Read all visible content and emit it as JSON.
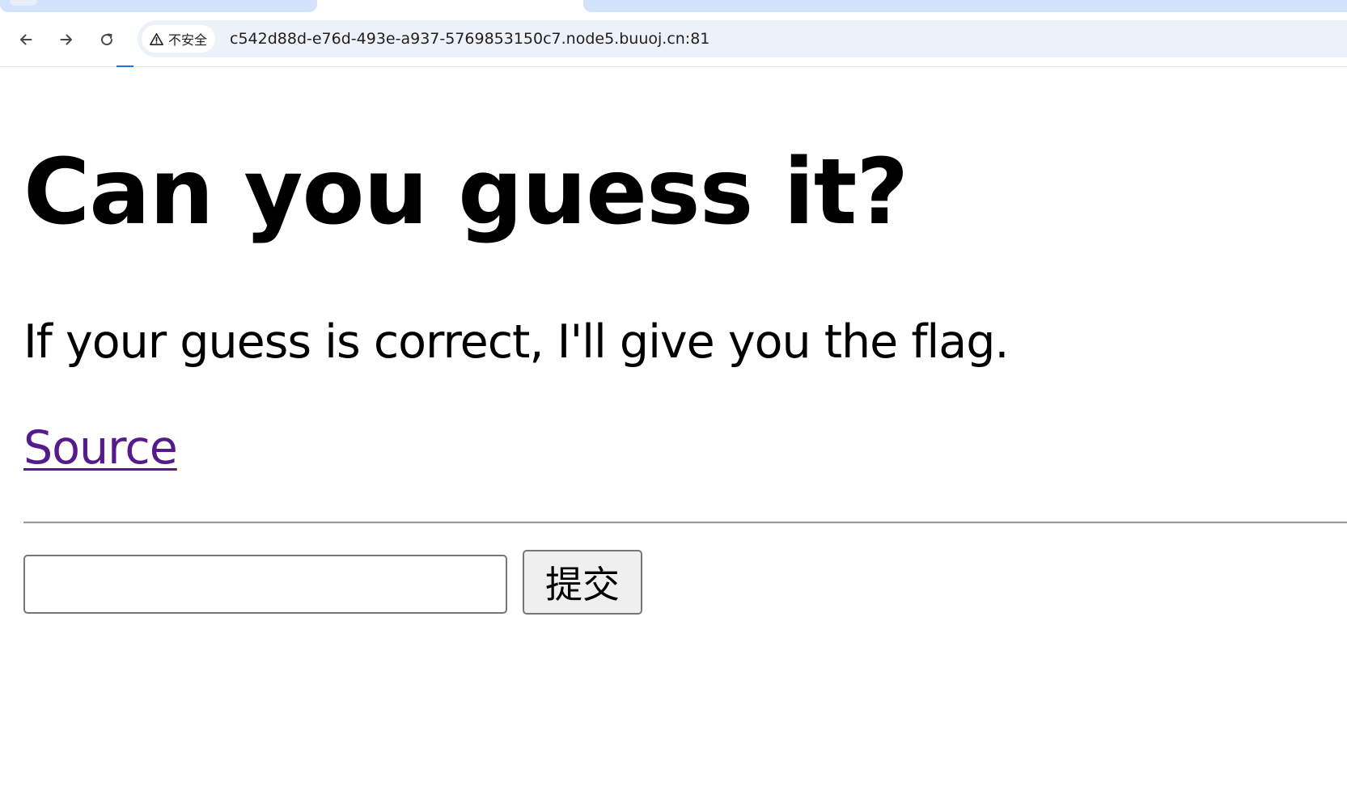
{
  "browser": {
    "security_label": "不安全",
    "url": "c542d88d-e76d-493e-a937-5769853150c7.node5.buuoj.cn:81"
  },
  "page": {
    "title": "Can you guess it?",
    "subtitle": "If your guess is correct, I'll give you the flag.",
    "source_link": "Source",
    "form": {
      "input_value": "",
      "submit_label": "提交"
    }
  },
  "colors": {
    "tab_accent": "#d3e3fd",
    "omnibox_bg": "#edf2fa",
    "visited_link": "#551a8b"
  }
}
